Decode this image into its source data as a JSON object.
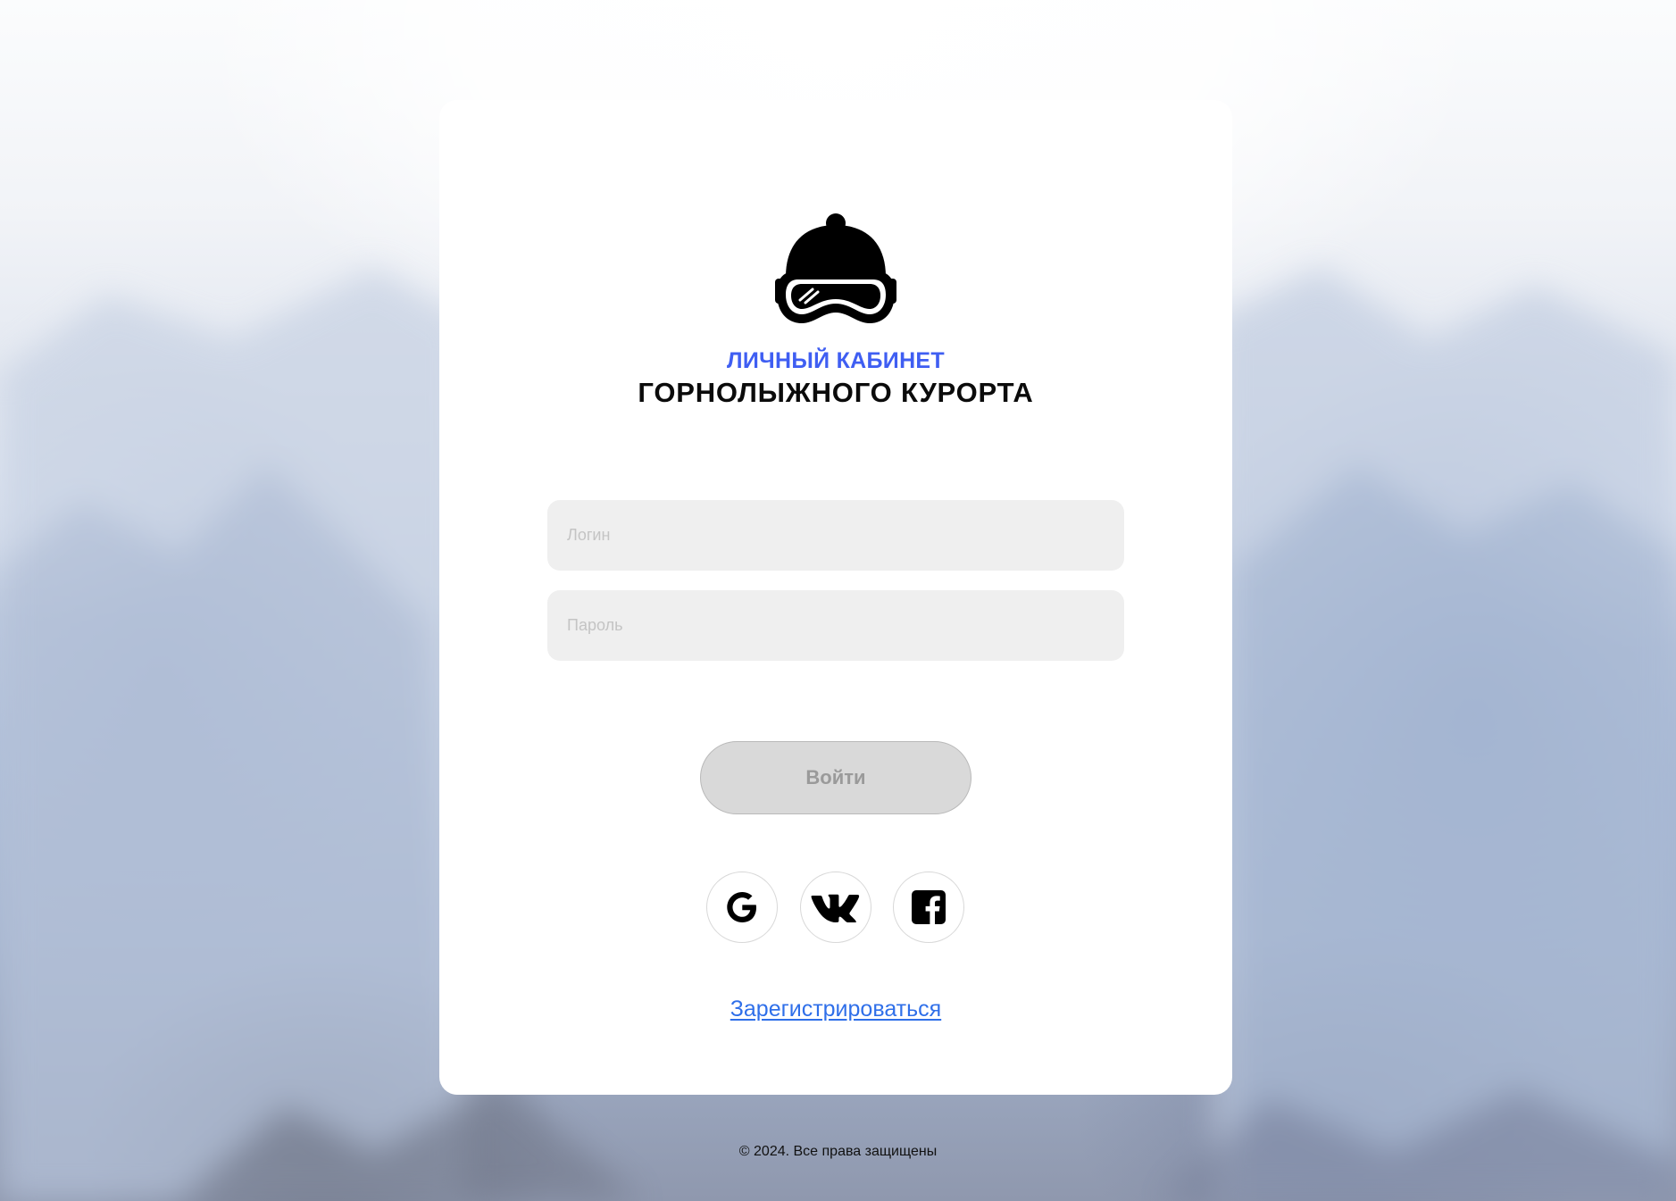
{
  "header": {
    "subtitle": "ЛИЧНЫЙ КАБИНЕТ",
    "title": "ГОРНОЛЫЖНОГО КУРОРТА",
    "logo_icon": "ski-helmet-goggles-icon"
  },
  "form": {
    "login_placeholder": "Логин",
    "login_value": "",
    "password_placeholder": "Пароль",
    "password_value": "",
    "submit_label": "Войти"
  },
  "social": {
    "google_icon": "google-icon",
    "vk_icon": "vk-icon",
    "facebook_icon": "facebook-icon"
  },
  "register_label": "Зарегистрироваться",
  "footer": {
    "copyright": "© 2024. Все права защищены"
  },
  "colors": {
    "accent": "#3f5ef2",
    "link": "#2f6fe9",
    "card_bg": "#ffffff",
    "input_bg": "#efefef",
    "button_bg": "#d9d9d9",
    "button_text": "#9a9a9a"
  }
}
